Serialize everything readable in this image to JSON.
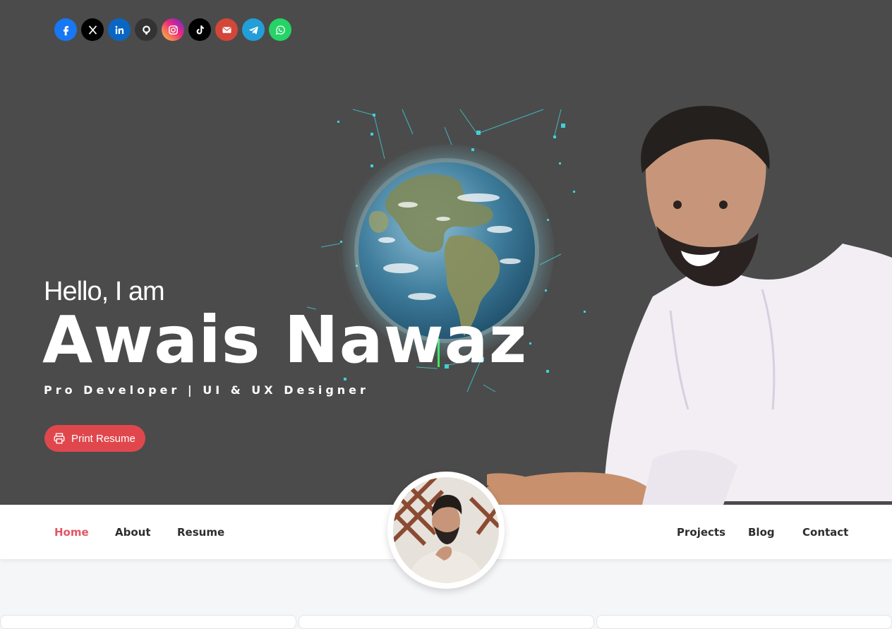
{
  "socials": [
    {
      "name": "facebook",
      "icon": "facebook-icon",
      "color": "#1877f2"
    },
    {
      "name": "x",
      "icon": "x-icon",
      "color": "#000000"
    },
    {
      "name": "linkedin",
      "icon": "linkedin-icon",
      "color": "#0a66c2"
    },
    {
      "name": "github",
      "icon": "github-icon",
      "color": "#333333"
    },
    {
      "name": "instagram",
      "icon": "instagram-icon",
      "color": "#e1306c"
    },
    {
      "name": "tiktok",
      "icon": "tiktok-icon",
      "color": "#000000"
    },
    {
      "name": "email",
      "icon": "envelope-icon",
      "color": "#d44638"
    },
    {
      "name": "telegram",
      "icon": "telegram-icon",
      "color": "#229ed9"
    },
    {
      "name": "whatsapp",
      "icon": "whatsapp-icon",
      "color": "#25d366"
    }
  ],
  "hero": {
    "greeting": "Hello, I am",
    "name": "Awais Nawaz",
    "tagline": "Pro Developer | UI & UX Designer",
    "print_button": "Print Resume",
    "background_color": "#4b4b4b",
    "accent_color": "#e0474c"
  },
  "nav": {
    "left": [
      "Home",
      "About",
      "Resume"
    ],
    "right": [
      "Projects",
      "Blog",
      "Contact"
    ],
    "active": "Home",
    "active_color": "#e45563"
  }
}
